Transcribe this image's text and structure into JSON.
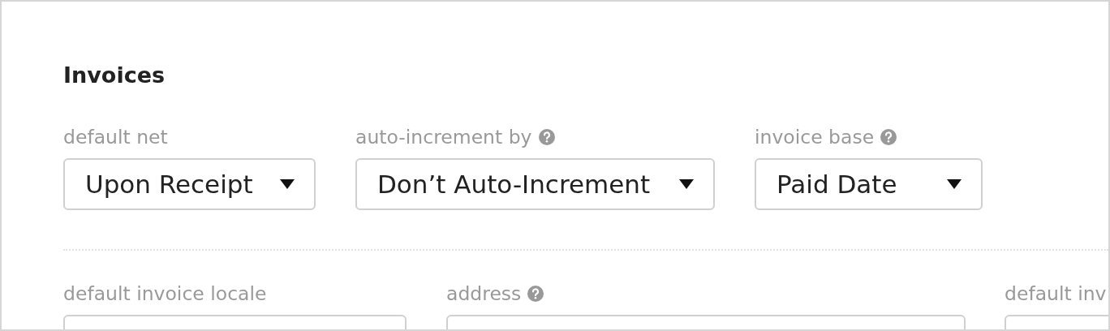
{
  "section": {
    "title": "Invoices"
  },
  "row_1": [
    {
      "label": "default net",
      "help": false,
      "value": "Upon Receipt",
      "kind": "select"
    },
    {
      "label": "auto-increment by",
      "help": true,
      "value": "Don’t Auto-Increment",
      "kind": "select"
    },
    {
      "label": "invoice base",
      "help": true,
      "value": "Paid Date",
      "kind": "select"
    }
  ],
  "row_2": [
    {
      "label": "default invoice locale",
      "help": false,
      "kind": "field"
    },
    {
      "label": "address",
      "help": true,
      "kind": "field"
    },
    {
      "label": "default inv",
      "help": false,
      "kind": "field"
    }
  ]
}
